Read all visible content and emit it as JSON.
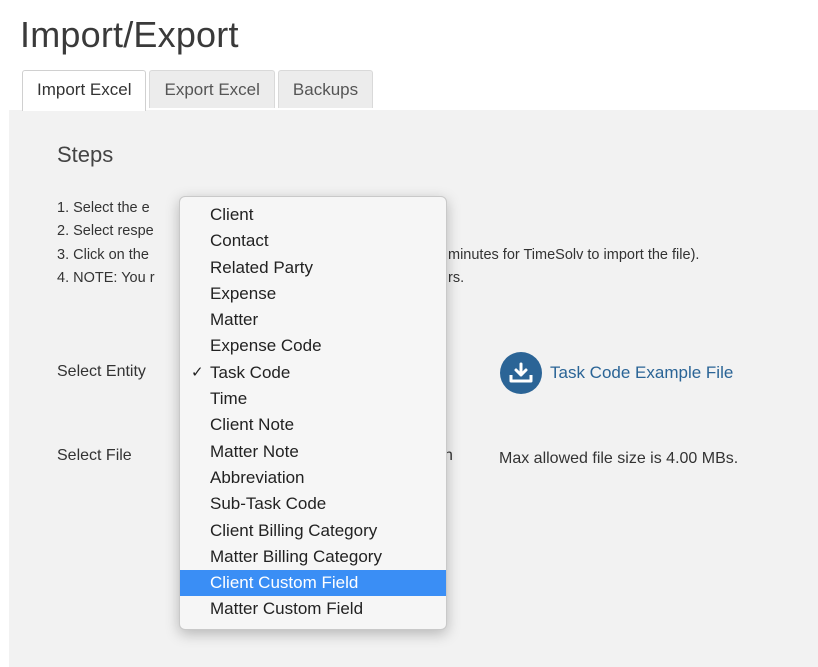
{
  "page": {
    "title": "Import/Export"
  },
  "tabs": [
    {
      "label": "Import Excel",
      "active": true
    },
    {
      "label": "Export Excel",
      "active": false
    },
    {
      "label": "Backups",
      "active": false
    }
  ],
  "steps": {
    "title": "Steps",
    "items": [
      {
        "left": "1. Select the e",
        "right": ""
      },
      {
        "left": "2. Select respe",
        "right": ""
      },
      {
        "left": "3. Click on the",
        "right": "minutes for TimeSolv to import the file)."
      },
      {
        "left": "4. NOTE: You r",
        "right": "rs."
      }
    ]
  },
  "entity": {
    "label": "Select Entity",
    "selected": "Task Code",
    "example_link": "Task Code Example File",
    "example_icon": "download-icon"
  },
  "file": {
    "label": "Select File",
    "fragment": "h",
    "hint": "Max allowed file size is 4.00 MBs."
  },
  "dropdown": {
    "options": [
      {
        "label": "Client",
        "checked": false,
        "highlighted": false
      },
      {
        "label": "Contact",
        "checked": false,
        "highlighted": false
      },
      {
        "label": "Related Party",
        "checked": false,
        "highlighted": false
      },
      {
        "label": "Expense",
        "checked": false,
        "highlighted": false
      },
      {
        "label": "Matter",
        "checked": false,
        "highlighted": false
      },
      {
        "label": "Expense Code",
        "checked": false,
        "highlighted": false
      },
      {
        "label": "Task Code",
        "checked": true,
        "highlighted": false
      },
      {
        "label": "Time",
        "checked": false,
        "highlighted": false
      },
      {
        "label": "Client Note",
        "checked": false,
        "highlighted": false
      },
      {
        "label": "Matter Note",
        "checked": false,
        "highlighted": false
      },
      {
        "label": "Abbreviation",
        "checked": false,
        "highlighted": false
      },
      {
        "label": "Sub-Task Code",
        "checked": false,
        "highlighted": false
      },
      {
        "label": "Client Billing Category",
        "checked": false,
        "highlighted": false
      },
      {
        "label": "Matter Billing Category",
        "checked": false,
        "highlighted": false
      },
      {
        "label": "Client Custom Field",
        "checked": false,
        "highlighted": true
      },
      {
        "label": "Matter Custom Field",
        "checked": false,
        "highlighted": false
      }
    ],
    "check_glyph": "✓"
  },
  "colors": {
    "accent": "#2b6496",
    "highlight": "#3a8ef5",
    "panel_bg": "#f2f2f2"
  }
}
